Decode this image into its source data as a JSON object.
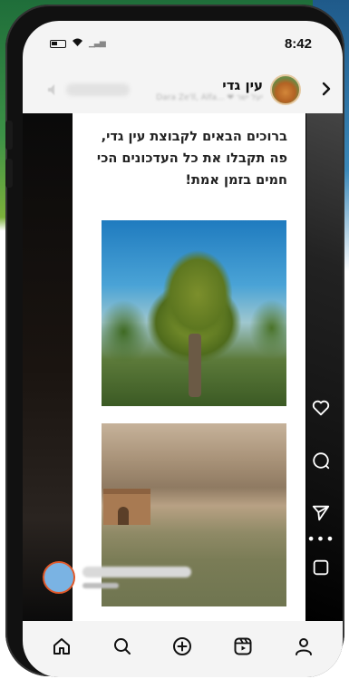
{
  "status_bar": {
    "time": "8:42"
  },
  "header": {
    "channel_name": "עין גדי",
    "subtitle": "Dara Ze'll, Alfa... ❤ יעל ישר",
    "back_icon": "chevron-right-icon"
  },
  "post": {
    "text": "ברוכים הבאים לקבוצת עין גדי, פה תקבלו את כל העדכונים הכי חמים בזמן אמת!",
    "images": [
      "tree-photo",
      "desert-ruin-photo"
    ]
  },
  "actions": [
    "heart-icon",
    "comment-icon",
    "send-icon",
    "more-icon",
    "save-icon"
  ],
  "nav": [
    "home-icon",
    "search-icon",
    "create-icon",
    "reels-icon",
    "profile-icon"
  ],
  "colors": {
    "bar_bg": "#f4f4f4",
    "avatar_ring": "#e0592a",
    "avatar_fill": "#7ab3e3"
  }
}
